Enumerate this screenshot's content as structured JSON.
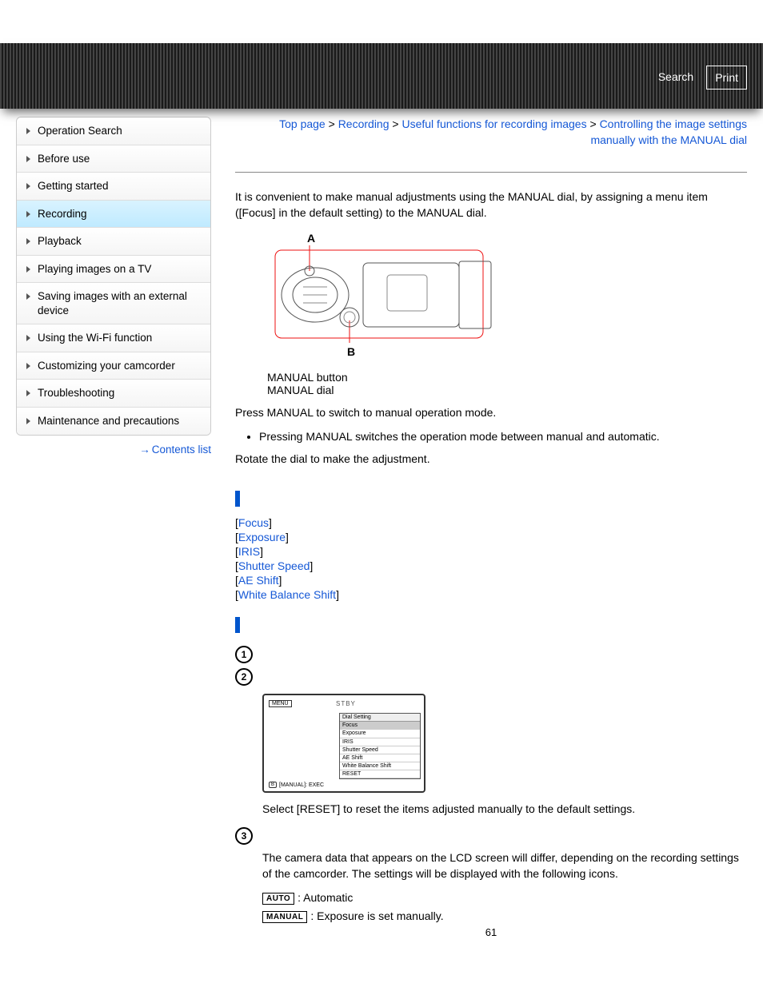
{
  "banner": {
    "search": "Search",
    "print": "Print"
  },
  "sidebar": {
    "items": [
      "Operation Search",
      "Before use",
      "Getting started",
      "Recording",
      "Playback",
      "Playing images on a TV",
      "Saving images with an external device",
      "Using the Wi-Fi function",
      "Customizing your camcorder",
      "Troubleshooting",
      "Maintenance and precautions"
    ],
    "active_index": 3,
    "contents_list": "Contents list"
  },
  "breadcrumb": {
    "parts": [
      "Top page",
      "Recording",
      "Useful functions for recording images"
    ],
    "tail": "Controlling the image settings manually with the MANUAL dial",
    "sep": " > "
  },
  "intro": "It is convenient to make manual adjustments using the MANUAL dial, by assigning a menu item ([Focus] in the default setting) to the MANUAL dial.",
  "fig_labels": {
    "a": "A",
    "b": "B",
    "a_desc": "MANUAL button",
    "b_desc": "MANUAL dial"
  },
  "step_press": "Press MANUAL to switch to manual operation mode.",
  "press_bullet": "Pressing MANUAL switches the operation mode between manual and automatic.",
  "step_rotate": "Rotate the dial to make the adjustment.",
  "dial_items": [
    "Focus",
    "Exposure",
    "IRIS",
    "Shutter Speed",
    "AE Shift",
    "White Balance Shift"
  ],
  "lcd": {
    "menu": "MENU",
    "stby": "STBY",
    "panel_title": "Dial Setting",
    "rows": [
      "Focus",
      "Exposure",
      "IRIS",
      "Shutter Speed",
      "AE Shift",
      "White Balance Shift",
      "RESET"
    ],
    "foot_btn": "B",
    "foot": "[MANUAL]: EXEC"
  },
  "reset_note": "Select [RESET] to reset the items adjusted manually to the default settings.",
  "camera_data_note": "The camera data that appears on the LCD screen will differ, depending on the recording settings of the camcorder. The settings will be displayed with the following icons.",
  "icon_auto": "AUTO",
  "icon_auto_desc": ": Automatic",
  "icon_manual": "MANUAL",
  "icon_manual_desc": ": Exposure is set manually.",
  "page_number": "61"
}
